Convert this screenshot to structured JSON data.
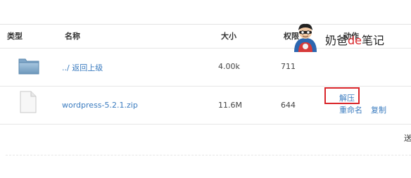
{
  "table": {
    "headers": {
      "type": "类型",
      "name": "名称",
      "size": "大小",
      "permission": "权限",
      "action": "动作"
    },
    "rows": [
      {
        "icon": "folder-icon",
        "name": "../ 返回上级",
        "size": "4.00k",
        "permission": "711"
      },
      {
        "icon": "file-icon",
        "name": "wordpress-5.2.1.zip",
        "size": "11.6M",
        "permission": "644",
        "actions": {
          "extract": "解压",
          "rename": "重命名",
          "separator": "|",
          "copy": "复制"
        }
      }
    ]
  },
  "watermark": {
    "part1": "奶爸",
    "part2": "de",
    "part3": "笔记"
  },
  "edge_text": "送",
  "colors": {
    "link": "#3a7bbf",
    "highlight": "#d9262b"
  }
}
